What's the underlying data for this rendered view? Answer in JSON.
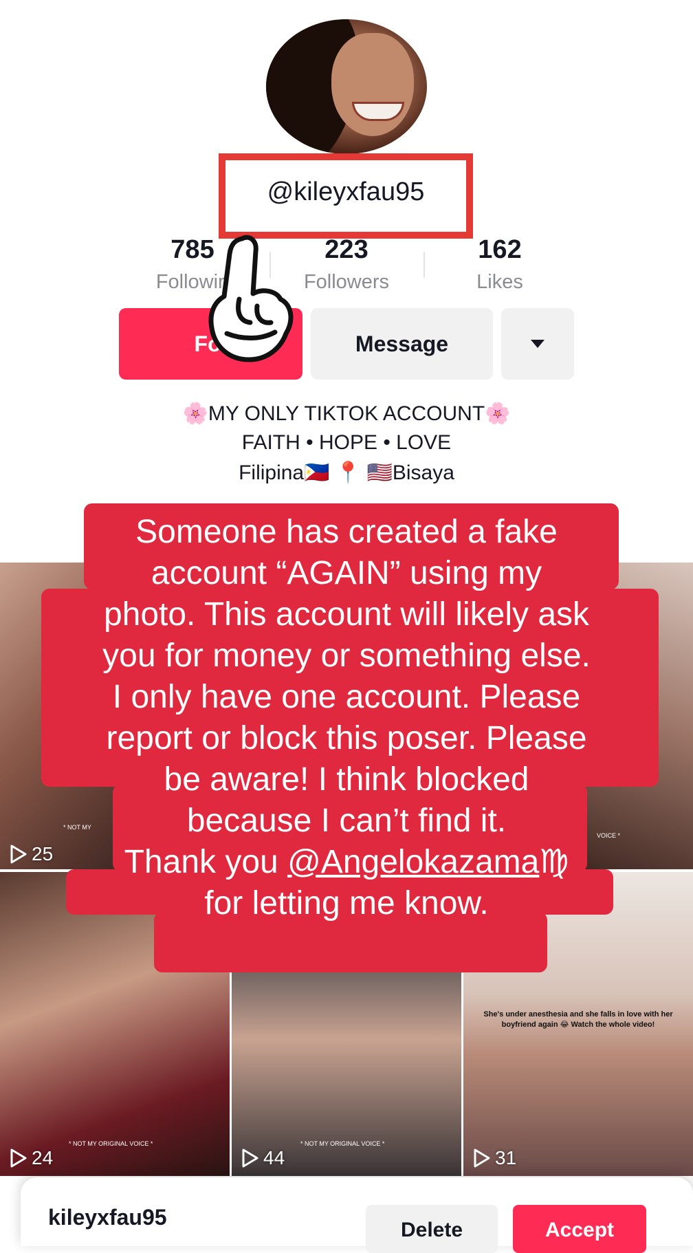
{
  "profile": {
    "handle": "@kileyxfau95",
    "stats": [
      {
        "value": "785",
        "label": "Followin"
      },
      {
        "value": "223",
        "label": "Followers"
      },
      {
        "value": "162",
        "label": "Likes"
      }
    ],
    "follow_label": "Fol",
    "message_label": "Message",
    "bio": {
      "line1": "🌸MY ONLY TIKTOK ACCOUNT🌸",
      "line2": "FAITH • HOPE • LOVE",
      "line3": "Filipina🇵🇭 📍 🇺🇸Bisaya"
    }
  },
  "caption": {
    "line1": "Someone has created a fake",
    "line2": "account “AGAIN” using my",
    "line3": "photo. This account will likely ask",
    "line4": "you for money or something else.",
    "line5": "I only have one account. Please",
    "line6": "report or block this poser. Please",
    "line7": "be aware! I think blocked",
    "line8": "because I can’t find it.",
    "line9_prefix": "Thank you ",
    "line9_link": "@Angelokazama",
    "line9_suffix": "♍",
    "line10": "for letting me know."
  },
  "videos": [
    {
      "views": "25",
      "overlay": "* NOT MY"
    },
    {
      "views": "",
      "overlay": "VOICE *"
    },
    {
      "views": "24",
      "overlay": "* NOT MY ORIGINAL VOICE *"
    },
    {
      "views": "44",
      "overlay": "* NOT MY ORIGINAL VOICE *"
    },
    {
      "views": "31",
      "overlay": "She's under anesthesia and she falls in love with her boyfriend again 😂 Watch the whole video!"
    }
  ],
  "request": {
    "name": "kileyxfau95",
    "delete_label": "Delete",
    "accept_label": "Accept"
  },
  "colors": {
    "accent": "#fe2c55",
    "highlight_box": "#e53935",
    "caption_bg": "#e0283f"
  }
}
